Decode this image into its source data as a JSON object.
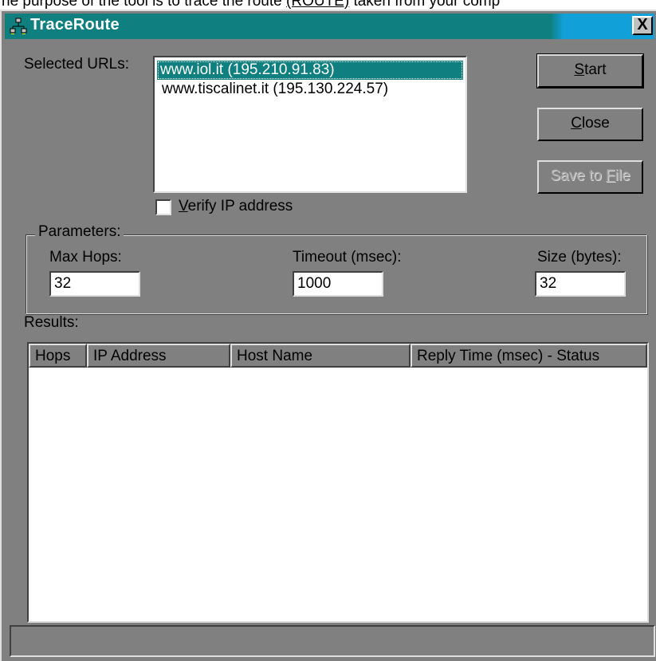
{
  "background_text": {
    "before": "he purpose of the tool is to trace the route",
    "link": "(ROUTE)",
    "after": "taken from your comp"
  },
  "window": {
    "title": "TraceRoute",
    "close_symbol": "X",
    "icon": "network-icon"
  },
  "urls": {
    "label": "Selected URLs:",
    "items": [
      {
        "text": "www.iol.it (195.210.91.83)",
        "selected": true
      },
      {
        "text": "www.tiscalinet.it (195.130.224.57)",
        "selected": false
      }
    ]
  },
  "buttons": {
    "start": {
      "access_key": "S",
      "rest": "tart"
    },
    "close": {
      "access_key": "C",
      "rest": "lose"
    },
    "save": {
      "prefix": "Save to ",
      "access_key": "F",
      "rest": "ile",
      "disabled": true
    }
  },
  "verify": {
    "access_key": "V",
    "rest": "erify IP address",
    "checked": false
  },
  "parameters": {
    "group_label": "Parameters:",
    "max_hops": {
      "label": "Max Hops:",
      "value": "32"
    },
    "timeout": {
      "label": "Timeout (msec):",
      "value": "1000"
    },
    "size": {
      "label": "Size (bytes):",
      "value": "32"
    }
  },
  "results": {
    "label": "Results:",
    "columns": [
      "Hops",
      "IP Address",
      "Host Name",
      "Reply Time (msec) - Status"
    ],
    "rows": []
  },
  "statusbar": {
    "text": ""
  },
  "colors": {
    "face": "#808080",
    "title_bar": "#0f7f7f",
    "title_bar_end": "#12a0d8",
    "selection": "#0f7f7f"
  }
}
